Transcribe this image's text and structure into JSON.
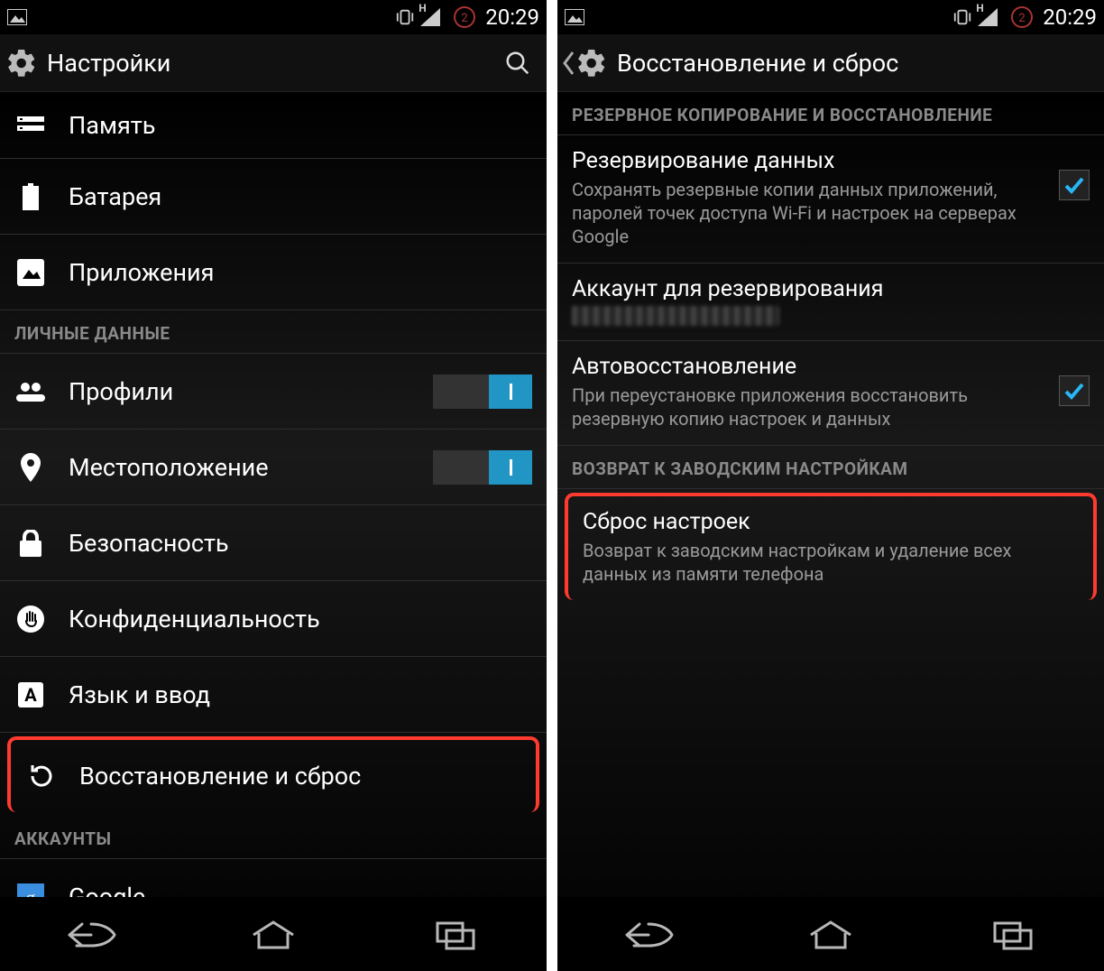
{
  "status": {
    "time": "20:29",
    "network_type": "H"
  },
  "left": {
    "title": "Настройки",
    "items": {
      "memory": "Память",
      "battery": "Батарея",
      "apps": "Приложения"
    },
    "section_personal": "ЛИЧНЫЕ ДАННЫЕ",
    "personal": {
      "profiles": "Профили",
      "location": "Местоположение",
      "security": "Безопасность",
      "privacy": "Конфиденциальность",
      "language": "Язык и ввод",
      "backup_reset": "Восстановление и сброс"
    },
    "section_accounts": "АККАУНТЫ",
    "accounts": {
      "google": "Google"
    }
  },
  "right": {
    "title": "Восстановление и сброс",
    "section_backup": "РЕЗЕРВНОЕ КОПИРОВАНИЕ И ВОССТАНОВЛЕНИЕ",
    "backup_data_title": "Резервирование данных",
    "backup_data_summary": "Сохранять резервные копии данных приложений, паролей точек доступа Wi-Fi и настроек на серверах Google",
    "backup_account_title": "Аккаунт для резервирования",
    "autorestore_title": "Автовосстановление",
    "autorestore_summary": "При переустановке приложения восстановить резервную копию настроек и данных",
    "section_factory": "ВОЗВРАТ К ЗАВОДСКИМ НАСТРОЙКАМ",
    "reset_title": "Сброс настроек",
    "reset_summary": "Возврат к заводским настройкам и удаление всех данных из памяти телефона"
  }
}
